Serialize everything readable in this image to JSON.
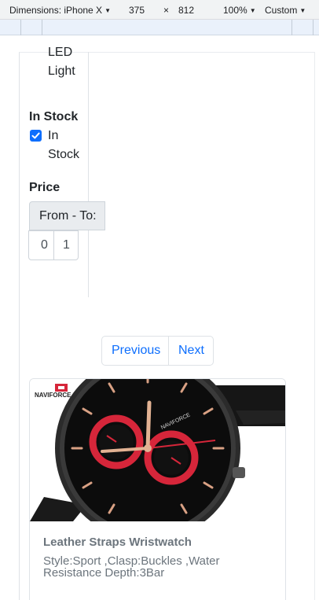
{
  "devtools": {
    "device_label": "Dimensions: iPhone X",
    "width": "375",
    "times": "×",
    "height": "812",
    "zoom": "100%",
    "throttle": "Custom"
  },
  "filters": {
    "category_tail": [
      "LED",
      "Light"
    ],
    "stock_heading": "In Stock",
    "stock_option": [
      "In",
      "Stock"
    ],
    "stock_checked": true,
    "price_heading": "Price",
    "price_button": "From - To:",
    "price_from_value": "0",
    "price_to_value": "1"
  },
  "pagination": {
    "previous": "Previous",
    "next": "Next"
  },
  "product": {
    "brand_logo": "NAVIFORCE",
    "title": "Leather Straps Wristwatch",
    "description": "Style:Sport ,Clasp:Buckles ,Water Resistance Depth:3Bar"
  },
  "colors": {
    "accent": "#0d6efd",
    "muted_text": "#6c757d",
    "watch_red": "#d6263a"
  }
}
